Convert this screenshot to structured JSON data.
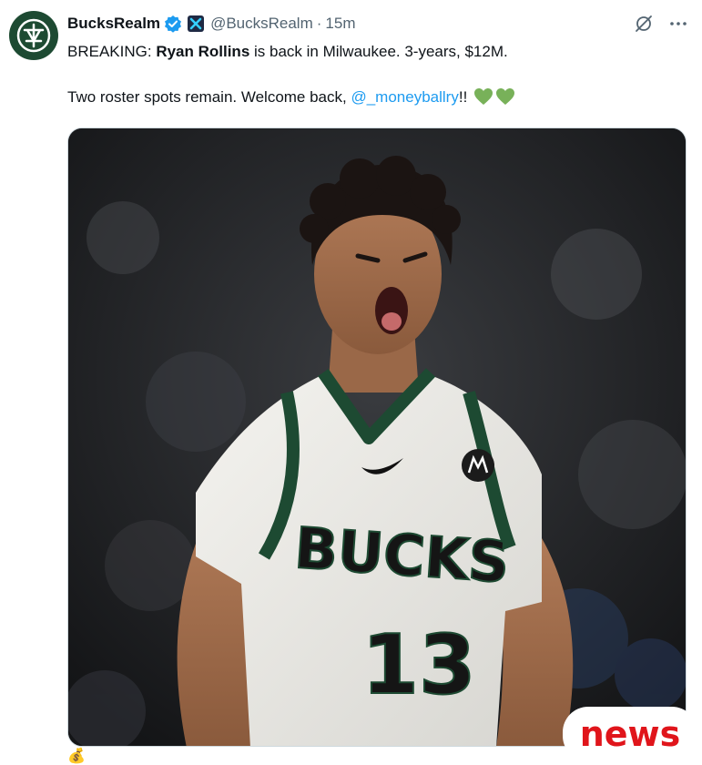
{
  "tweet": {
    "display_name": "BucksRealm",
    "handle": "@BucksRealm",
    "separator": "·",
    "time": "15m",
    "text_line1_prefix": "BREAKING: ",
    "text_line1_bold": "Ryan Rollins",
    "text_line1_suffix": " is back in Milwaukee. 3-years, $12M.",
    "text_line2_prefix": "Two roster spots remain. Welcome back, ",
    "mention": "@_moneyballry",
    "text_line2_suffix": "!!",
    "emoji_hearts": [
      "green-heart",
      "green-heart"
    ]
  },
  "media": {
    "jersey_wordmark": "BUCKS",
    "jersey_number": "13"
  },
  "overlay": {
    "badge_text": "news",
    "trailing_emoji": "💰"
  },
  "icons": {
    "verified": "verified-badge-icon",
    "affiliate": "affiliate-badge-icon",
    "grok": "grok-icon",
    "more": "more-options-icon"
  },
  "colors": {
    "link": "#1d9bf0",
    "verified": "#1d9bf0",
    "secondary_text": "#536471",
    "bucks_green": "#1d4a32",
    "news_red": "#e0151b"
  }
}
